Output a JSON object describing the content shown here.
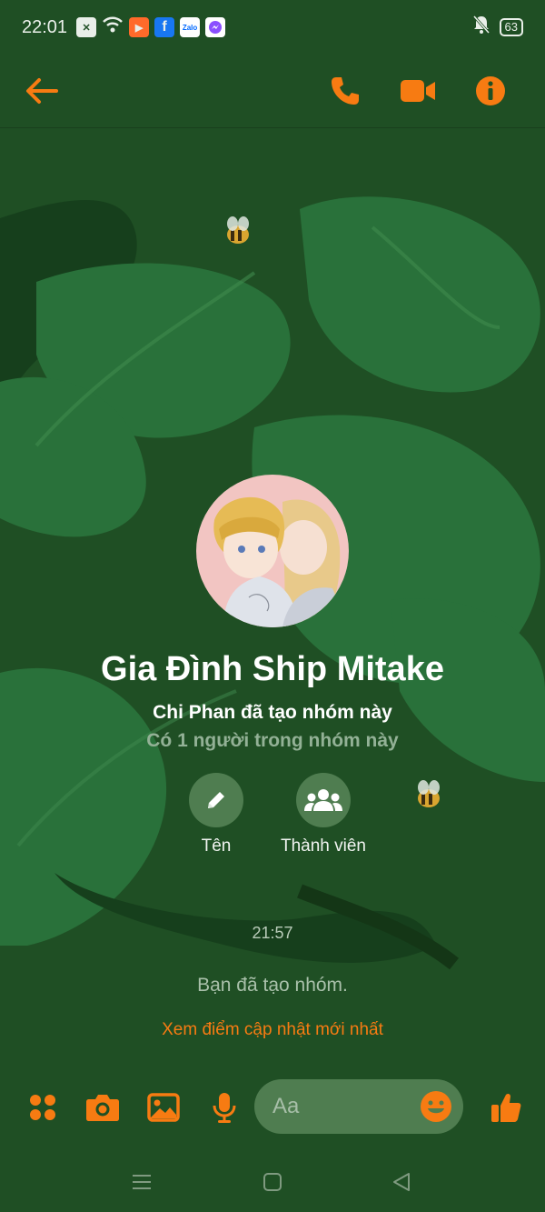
{
  "status_bar": {
    "time": "22:01",
    "battery": "63"
  },
  "colors": {
    "accent": "#f77b12",
    "background": "#1f4f24",
    "leaf": "#29713a",
    "circle_button": "#4f7d50"
  },
  "icons": {
    "top": [
      "back-arrow-icon",
      "phone-icon",
      "video-call-icon",
      "info-icon"
    ],
    "composer": [
      "apps-icon",
      "camera-icon",
      "image-icon",
      "microphone-icon",
      "emoji-icon",
      "thumbs-up-icon"
    ]
  },
  "group": {
    "name": "Gia Đình Ship Mitake",
    "creator_line": "Chi Phan đã tạo nhóm này",
    "members_line": "Có 1 người trong nhóm này"
  },
  "actions": {
    "name_label": "Tên",
    "members_label": "Thành viên"
  },
  "chat": {
    "timestamp": "21:57",
    "system_message": "Bạn đã tạo nhóm.",
    "update_link": "Xem điểm cập nhật mới nhất"
  },
  "composer": {
    "placeholder": "Aa"
  }
}
